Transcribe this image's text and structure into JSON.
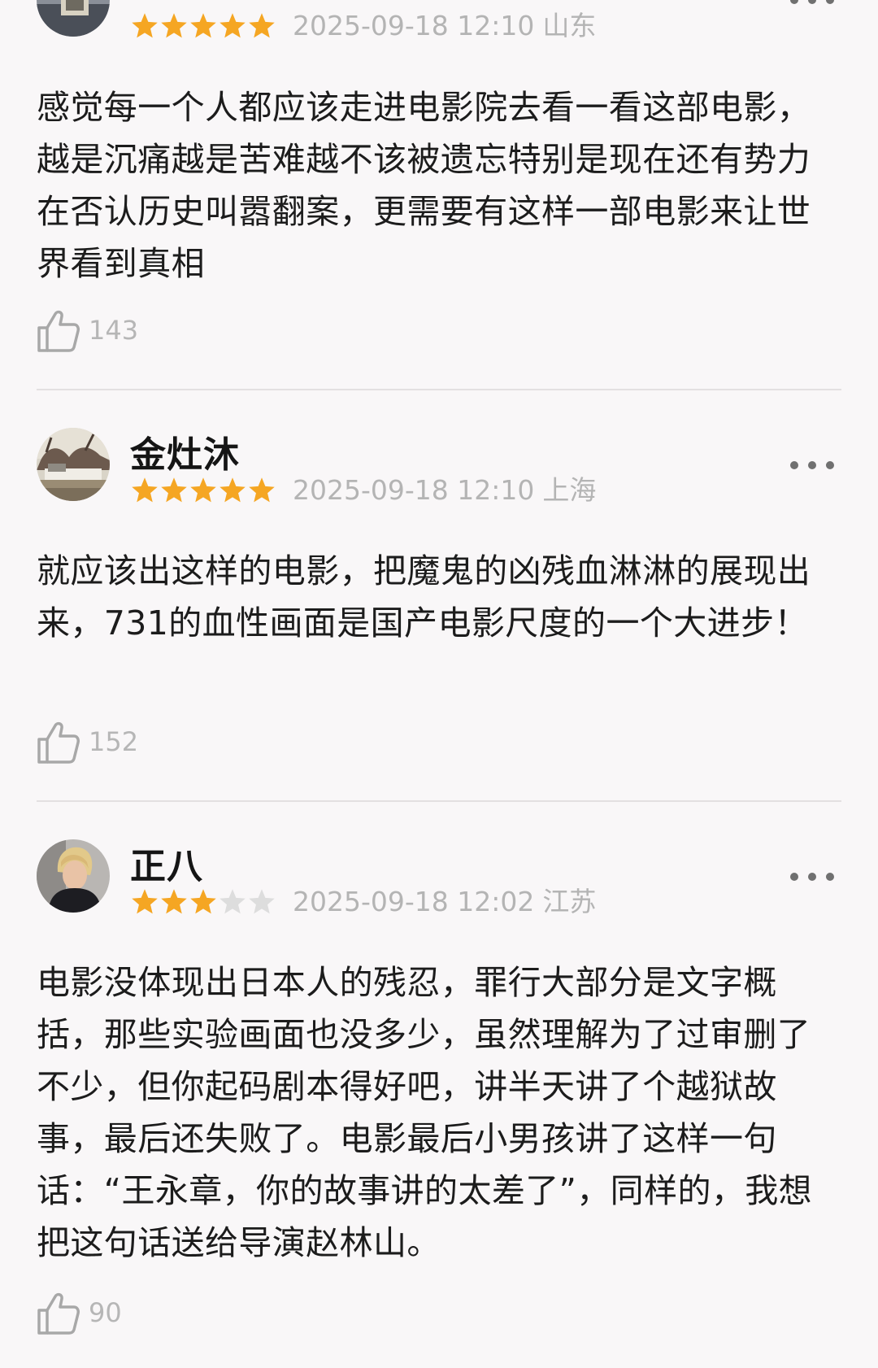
{
  "colors": {
    "background": "#f9f7f8",
    "star_filled": "#f5a623",
    "star_empty": "#dddddd",
    "meta_text": "#b4b4b4",
    "divider": "#e3e0e1"
  },
  "reviews": [
    {
      "username": "",
      "rating": 5,
      "rating_max": 5,
      "date": "2025-09-18 12:10",
      "location": "山东",
      "text": "感觉每一个人都应该走进电影院去看一看这部电影，越是沉痛越是苦难越不该被遗忘特别是现在还有势力在否认历史叫嚣翻案，更需要有这样一部电影来让世界看到真相",
      "likes": "143",
      "avatar_icon": "avatar-photo-partial",
      "like_icon": "thumbs-up-icon",
      "more_icon": "more-dots-icon"
    },
    {
      "username": "金灶沐",
      "rating": 5,
      "rating_max": 5,
      "date": "2025-09-18 12:10",
      "location": "上海",
      "text": "就应该出这样的电影，把魔鬼的凶残血淋淋的展现出来，731的血性画面是国产电影尺度的一个大进步！",
      "likes": "152",
      "avatar_icon": "avatar-landscape-photo",
      "like_icon": "thumbs-up-icon",
      "more_icon": "more-dots-icon"
    },
    {
      "username": "正八",
      "rating": 3,
      "rating_max": 5,
      "date": "2025-09-18 12:02",
      "location": "江苏",
      "text": "电影没体现出日本人的残忍，罪行大部分是文字概括，那些实验画面也没多少，虽然理解为了过审删了不少，但你起码剧本得好吧，讲半天讲了个越狱故事，最后还失败了。电影最后小男孩讲了这样一句话：“王永章，你的故事讲的太差了”，同样的，我想把这句话送给导演赵林山。",
      "likes": "90",
      "avatar_icon": "avatar-person-photo",
      "like_icon": "thumbs-up-icon",
      "more_icon": "more-dots-icon"
    }
  ]
}
